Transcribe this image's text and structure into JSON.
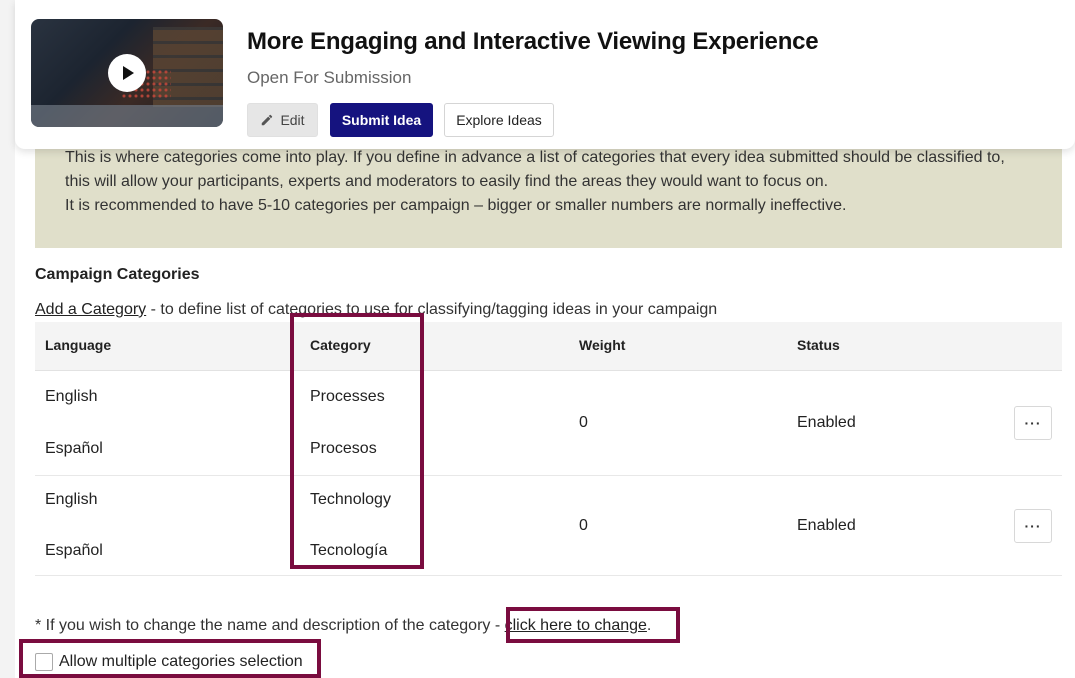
{
  "campaign": {
    "title": "More Engaging and Interactive Viewing Experience",
    "status": "Open For Submission",
    "thumbnail_icon": "play-icon",
    "buttons": {
      "edit": "Edit",
      "submit": "Submit Idea",
      "explore": "Explore Ideas"
    }
  },
  "notice": {
    "lines": [
      "This is where categories come into play. If you define in advance a list of categories that every idea submitted should be classified to,",
      "this will allow your participants, experts and moderators to easily find the areas they would want to focus on.",
      "It is recommended to have 5-10 categories per campaign – bigger or smaller numbers are normally ineffective."
    ]
  },
  "categories": {
    "section_title": "Campaign Categories",
    "add_link": "Add a Category",
    "add_suffix": " - to define list of categories to use for classifying/tagging ideas in your campaign",
    "headers": {
      "language": "Language",
      "category": "Category",
      "weight": "Weight",
      "status": "Status"
    },
    "groups": [
      {
        "entries": [
          {
            "language": "English",
            "category": "Processes"
          },
          {
            "language": "Español",
            "category": "Procesos"
          }
        ],
        "weight": "0",
        "status": "Enabled",
        "actions_label": "···"
      },
      {
        "entries": [
          {
            "language": "English",
            "category": "Technology"
          },
          {
            "language": "Español",
            "category": "Tecnología"
          }
        ],
        "weight": "0",
        "status": "Enabled",
        "actions_label": "···"
      }
    ],
    "footnote_prefix": "* If you wish to change the name and description of the category - ",
    "footnote_link": "click here to change",
    "footnote_suffix": ".",
    "multi_select_label": "Allow multiple categories selection"
  },
  "colors": {
    "primary": "#15137f",
    "notice_bg": "#e0dfca",
    "highlight": "#7a0c3f"
  }
}
